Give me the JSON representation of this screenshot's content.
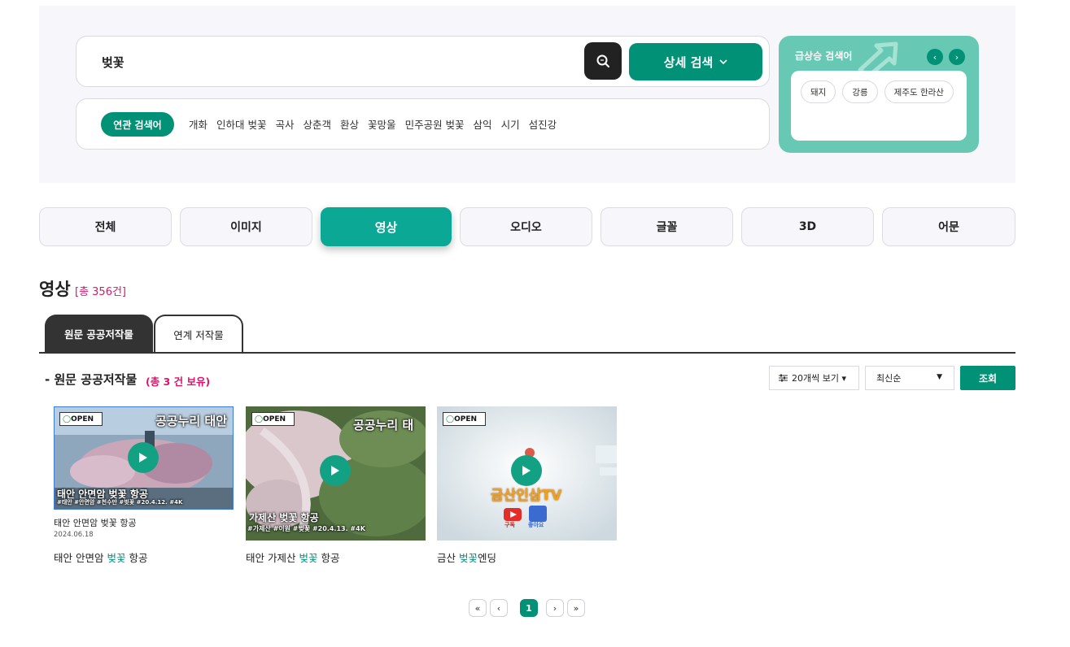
{
  "search": {
    "value": "벚꽃",
    "detail_label": "상세 검색"
  },
  "related": {
    "badge": "연관 검색어",
    "items": [
      "개화",
      "인하대 벚꽃",
      "곡사",
      "상춘객",
      "환상",
      "꽃망울",
      "민주공원 벚꽃",
      "삼익",
      "시기",
      "섬진강"
    ]
  },
  "trending": {
    "title": "급상승 검색어",
    "tags": [
      "돼지",
      "강릉",
      "제주도 한라산"
    ]
  },
  "type_tabs": [
    "전체",
    "이미지",
    "영상",
    "오디오",
    "글꼴",
    "3D",
    "어문"
  ],
  "active_type": "영상",
  "section": {
    "title": "영상",
    "count": "[총 356건]"
  },
  "sub_tabs": {
    "active": "원문 공공저작물",
    "inactive": "연계 저작물"
  },
  "list": {
    "heading": "- 원문 공공저작물",
    "count": "(총 3 건 보유)"
  },
  "controls": {
    "view_label": "20개씩 보기 ▾",
    "sort_label": "최신순",
    "query_label": "조회"
  },
  "cards": [
    {
      "title_before": "태안 안면암 ",
      "title_highlight": "벚꽃",
      "title_after": " 항공",
      "thumb_badge": "OPEN",
      "thumb_top_text": "공공누리 태안",
      "thumb_bottom_text": "태안 안면암 벚꽃 항공",
      "thumb_tags": "#태안 #안면암 #천수만 #벚꽃 #20.4.12. #4K",
      "thumb_caption": "태안 안면암 벚꽃 항공",
      "thumb_date": "2024.06.18"
    },
    {
      "title_before": "태안 가제산 ",
      "title_highlight": "벚꽃",
      "title_after": " 항공",
      "thumb_badge": "OPEN",
      "thumb_top_text": "공공누리 태",
      "thumb_bottom_text": "가제산 벚꽃 항공",
      "thumb_tags": "#가제산 #이원 #벚꽃 #20.4.13. #4K"
    },
    {
      "title_before": "금산 ",
      "title_highlight": "벚꽃",
      "title_after": "엔딩",
      "thumb_badge": "OPEN",
      "thumb_logo": "금산인삼TV",
      "thumb_sub1": "구독",
      "thumb_sub2": "좋아요"
    }
  ],
  "pagination": {
    "first": "«",
    "prev": "‹",
    "current": "1",
    "next": "›",
    "last": "»"
  },
  "colors": {
    "brand": "#009177",
    "accent": "#e0126a",
    "trend_bg": "#67c9b3",
    "active_tab": "#0ba895"
  },
  "icons": [
    "search-icon",
    "chevron-down-icon",
    "trend-arrow-icon",
    "arrow-left-icon",
    "arrow-right-icon",
    "filter-icon",
    "play-icon"
  ]
}
